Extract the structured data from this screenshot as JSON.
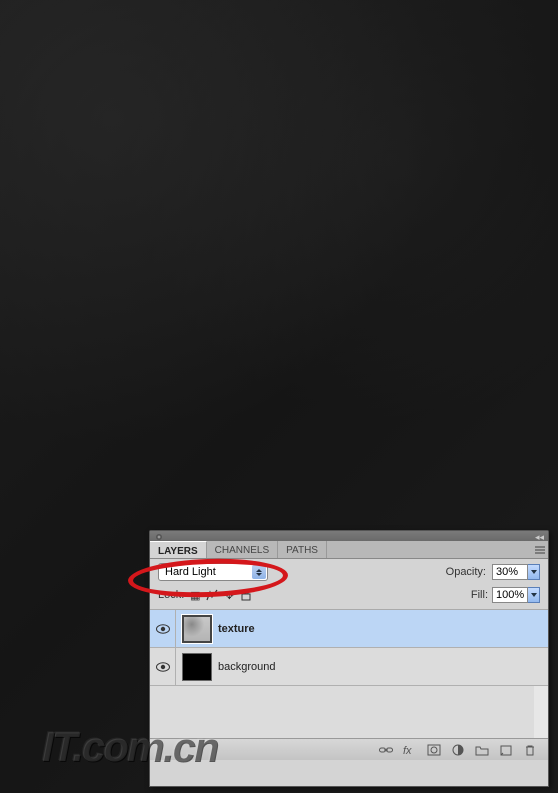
{
  "tabs": {
    "layers": "LAYERS",
    "channels": "CHANNELS",
    "paths": "PATHS"
  },
  "blend_mode": "Hard Light",
  "opacity": {
    "label": "Opacity:",
    "value": "30%"
  },
  "fill": {
    "label": "Fill:",
    "value": "100%"
  },
  "lock": {
    "label": "Lock:"
  },
  "layers": [
    {
      "name": "texture",
      "selected": true
    },
    {
      "name": "background",
      "selected": false
    }
  ],
  "logo_text": "IT.com.cn",
  "annotation_color": "#d4171b"
}
